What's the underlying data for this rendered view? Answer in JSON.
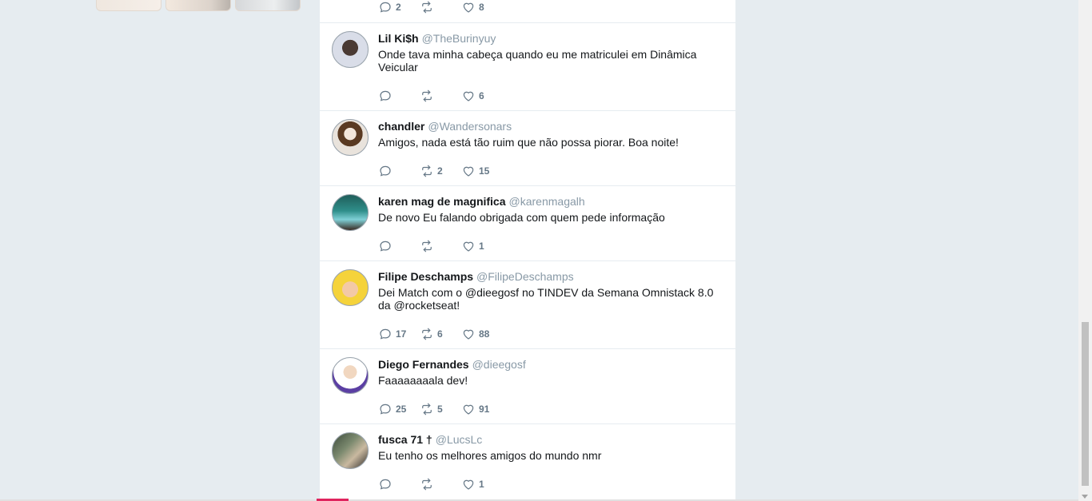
{
  "colors": {
    "background": "#e6ecf0",
    "card": "#ffffff",
    "handle": "#8899a6",
    "action": "#657786",
    "progress_accent": "#e0245e"
  },
  "icons": {
    "reply": "reply-icon",
    "retweet": "retweet-icon",
    "like": "heart-icon"
  },
  "prev_tweet_actions": {
    "replies": "2",
    "retweets": "",
    "likes": "8"
  },
  "tweets": [
    {
      "name": "Lil Ki$h",
      "handle": "@TheBurinyuy",
      "text": "Onde tava minha cabeça quando eu me matriculei em Dinâmica Veicular",
      "replies": "",
      "retweets": "",
      "likes": "6"
    },
    {
      "name": "chandler",
      "handle": "@Wandersonars",
      "text": "Amigos, nada está tão ruim que não possa piorar. Boa noite!",
      "replies": "",
      "retweets": "2",
      "likes": "15"
    },
    {
      "name": "karen mag de magnifica",
      "handle": "@karenmagalh",
      "text": "De novo Eu falando obrigada com quem pede informação",
      "replies": "",
      "retweets": "",
      "likes": "1"
    },
    {
      "name": "Filipe Deschamps",
      "handle": "@FilipeDeschamps",
      "text": "Dei Match com o @dieegosf no TINDEV da Semana Omnistack 8.0 da @rocketseat!",
      "replies": "17",
      "retweets": "6",
      "likes": "88"
    },
    {
      "name": "Diego Fernandes",
      "handle": "@dieegosf",
      "text": "Faaaaaaaala dev!",
      "replies": "25",
      "retweets": "5",
      "likes": "91"
    },
    {
      "name": "fusca 71 †",
      "handle": "@LucsLc",
      "text": "Eu tenho os melhores amigos do mundo nmr",
      "replies": "",
      "retweets": "",
      "likes": "1"
    }
  ]
}
